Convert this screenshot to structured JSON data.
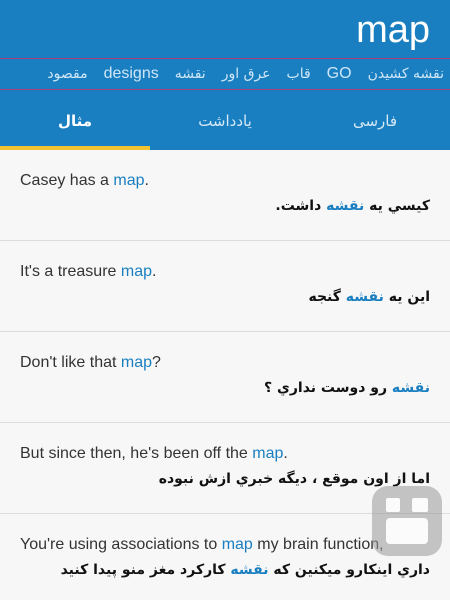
{
  "header": {
    "title": "map"
  },
  "related_words": [
    "نقشه کشیدن",
    "GO",
    "قاب",
    "عرق اور",
    "نقشه",
    "designs",
    "مقصود"
  ],
  "tabs": [
    {
      "label": "فارسی",
      "active": false
    },
    {
      "label": "یادداشت",
      "active": false
    },
    {
      "label": "مثال",
      "active": true
    }
  ],
  "examples": [
    {
      "en_before": "Casey has a ",
      "en_hl": "map",
      "en_after": ".",
      "fa_before": "کيسي يه ",
      "fa_hl": "نقشه",
      "fa_after": " داشت."
    },
    {
      "en_before": "It's a treasure ",
      "en_hl": "map",
      "en_after": ".",
      "fa_before": "اين يه ",
      "fa_hl": "نقشه",
      "fa_after": " گنجه"
    },
    {
      "en_before": "Don't like that ",
      "en_hl": "map",
      "en_after": "?",
      "fa_before": "",
      "fa_hl": "نقشه",
      "fa_after": " رو دوست نداري ؟"
    },
    {
      "en_before": "But since then, he's been off the ",
      "en_hl": "map",
      "en_after": ".",
      "fa_before": "اما از اون موقع ، ديگه خبري ازش نبوده",
      "fa_hl": "",
      "fa_after": ""
    },
    {
      "en_before": "You're using associations to ",
      "en_hl": "map",
      "en_after": " my brain function,",
      "fa_before": "داري اينکارو ميکنين که ",
      "fa_hl": "نقشه",
      "fa_after": " کارکرد مغز منو پيدا کنيد"
    }
  ],
  "colors": {
    "primary": "#1a7fc1",
    "tab_indicator": "#f2c230",
    "highlight": "#1a7fc1"
  },
  "watermark_icon": "app-logo-watermark-icon"
}
